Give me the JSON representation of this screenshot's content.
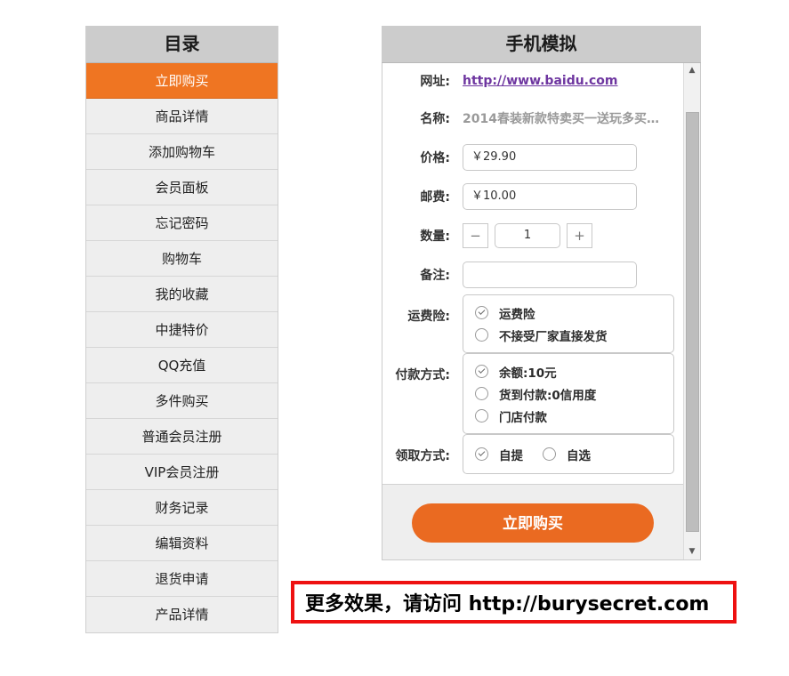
{
  "sidebar": {
    "title": "目录",
    "items": [
      {
        "label": "立即购买",
        "active": true
      },
      {
        "label": "商品详情",
        "active": false
      },
      {
        "label": "添加购物车",
        "active": false
      },
      {
        "label": "会员面板",
        "active": false
      },
      {
        "label": "忘记密码",
        "active": false
      },
      {
        "label": "购物车",
        "active": false
      },
      {
        "label": "我的收藏",
        "active": false
      },
      {
        "label": "中捷特价",
        "active": false
      },
      {
        "label": "QQ充值",
        "active": false
      },
      {
        "label": "多件购买",
        "active": false
      },
      {
        "label": "普通会员注册",
        "active": false
      },
      {
        "label": "VIP会员注册",
        "active": false
      },
      {
        "label": "财务记录",
        "active": false
      },
      {
        "label": "编辑资料",
        "active": false
      },
      {
        "label": "退货申请",
        "active": false
      },
      {
        "label": "产品详情",
        "active": false
      }
    ]
  },
  "phone": {
    "title": "手机模拟",
    "fields": {
      "url": {
        "label": "网址:",
        "value": "http://www.baidu.com"
      },
      "name": {
        "label": "名称:",
        "value": "2014春装新款特卖买一送玩多买…"
      },
      "price": {
        "label": "价格:",
        "value": "￥29.90",
        "placeholder": ""
      },
      "shipping": {
        "label": "邮费:",
        "value": "￥10.00",
        "placeholder": ""
      },
      "quantity": {
        "label": "数量:",
        "value": "1",
        "minus": "−",
        "plus": "+"
      },
      "remark": {
        "label": "备注:",
        "value": "",
        "placeholder": ""
      }
    },
    "insurance": {
      "label": "运费险:",
      "options": [
        {
          "text": "运费险",
          "checked": true
        },
        {
          "text": "不接受厂家直接发货",
          "checked": false
        }
      ]
    },
    "payment": {
      "label": "付款方式:",
      "options": [
        {
          "text": "余额:10元",
          "checked": true
        },
        {
          "text": "货到付款:0信用度",
          "checked": false
        },
        {
          "text": "门店付款",
          "checked": false
        }
      ]
    },
    "pickup": {
      "label": "领取方式:",
      "options": [
        {
          "text": "自提",
          "checked": true
        },
        {
          "text": "自选",
          "checked": false
        }
      ]
    },
    "buy_button": "立即购买",
    "scrollbar": {
      "up": "▲",
      "down": "▼"
    }
  },
  "banner": {
    "text": "更多效果，请访问 http://burysecret.com",
    "border_color": "#ee1111"
  },
  "colors": {
    "accent_orange": "#ef7522",
    "header_grey": "#cccccc",
    "link_purple": "#6e36a0"
  }
}
